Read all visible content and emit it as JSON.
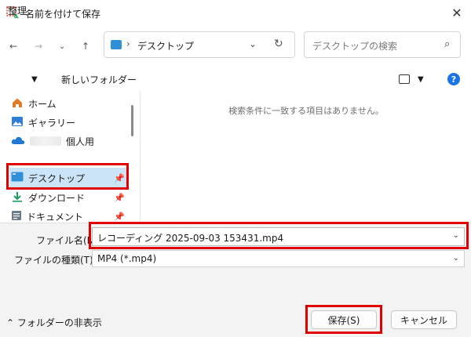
{
  "window": {
    "title": "名前を付けて保存"
  },
  "address": {
    "path": "デスクトップ",
    "separator": "›"
  },
  "search": {
    "placeholder": "デスクトップの検索"
  },
  "toolbar": {
    "organize": "整理",
    "new_folder": "新しいフォルダー"
  },
  "sidebar": {
    "items": [
      {
        "label": "ホーム",
        "icon": "home-icon"
      },
      {
        "label": "ギャラリー",
        "icon": "gallery-icon"
      },
      {
        "label": "個人用",
        "icon": "onedrive-icon"
      },
      {
        "label": "デスクトップ",
        "icon": "desktop-icon"
      },
      {
        "label": "ダウンロード",
        "icon": "download-icon"
      },
      {
        "label": "ドキュメント",
        "icon": "documents-icon"
      }
    ]
  },
  "content": {
    "empty_message": "検索条件に一致する項目はありません。"
  },
  "form": {
    "filename_label": "ファイル名(N):",
    "filename_value": "レコーディング 2025-09-03 153431.mp4",
    "filetype_label": "ファイルの種類(T):",
    "filetype_value": "MP4 (*.mp4)"
  },
  "footer": {
    "hide_folders": "フォルダーの非表示",
    "save": "保存(S)",
    "cancel": "キャンセル"
  },
  "colors": {
    "highlight": "#e00000",
    "selected": "#cce4f7",
    "accent": "#1a73e8"
  }
}
